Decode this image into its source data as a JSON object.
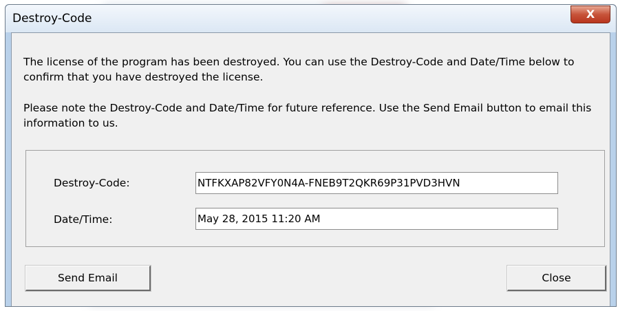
{
  "window": {
    "title": "Destroy-Code",
    "close_glyph": "X"
  },
  "message": {
    "paragraph1": "The license of the program has been destroyed. You can use the Destroy-Code and Date/Time below to confirm that you have destroyed the license.",
    "paragraph2": "Please note the Destroy-Code and Date/Time for future reference. Use the Send Email button to email this information to us."
  },
  "fields": {
    "destroy_code_label": "Destroy-Code:",
    "destroy_code_value": "NTFKXAP82VFY0N4A-FNEB9T2QKR69P31PVD3HVN",
    "datetime_label": "Date/Time:",
    "datetime_value": "May 28, 2015 11:20 AM"
  },
  "buttons": {
    "send_email": "Send Email",
    "close": "Close"
  },
  "colors": {
    "close_button": "#c7533a",
    "client_background": "#f0f0f0",
    "frame": "#b9d1ea"
  }
}
